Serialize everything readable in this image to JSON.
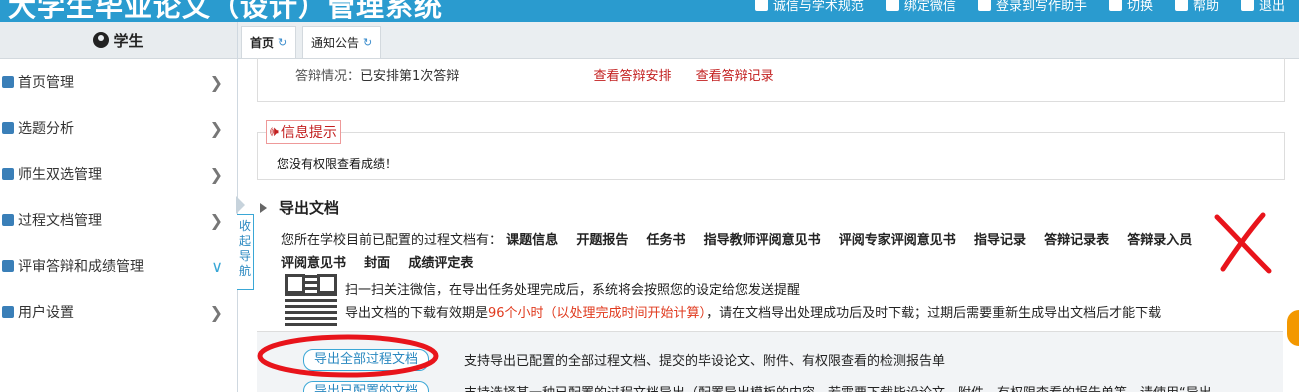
{
  "header": {
    "system_name": "大学生毕业论文（设计）管理系统",
    "links": [
      {
        "label": "诚信与学术规范",
        "icon": "document-icon"
      },
      {
        "label": "绑定微信",
        "icon": "wechat-icon"
      },
      {
        "label": "登录到写作助手",
        "icon": "login-icon"
      },
      {
        "label": "切换",
        "icon": "switch-icon"
      },
      {
        "label": "帮助",
        "icon": "help-icon"
      },
      {
        "label": "退出",
        "icon": "logout-icon"
      }
    ]
  },
  "sidebar": {
    "role": "学生",
    "items": [
      {
        "label": "首页管理",
        "icon": "wrench-icon"
      },
      {
        "label": "选题分析",
        "icon": "list-icon"
      },
      {
        "label": "师生双选管理",
        "icon": "users-icon"
      },
      {
        "label": "过程文档管理",
        "icon": "folder-icon"
      },
      {
        "label": "评审答辩和成绩管理",
        "icon": "chart-icon"
      },
      {
        "label": "用户设置",
        "icon": "user-icon"
      }
    ],
    "collapse_label": "收起导航"
  },
  "tabs": [
    {
      "label": "首页",
      "icon": "refresh-icon"
    },
    {
      "label": "通知公告",
      "icon": "refresh-icon"
    }
  ],
  "defense": {
    "status_label": "答辩情况：",
    "status_value": "已安排第1次答辩",
    "view_schedule": "查看答辩安排",
    "view_record": "查看答辩记录"
  },
  "info": {
    "title": "信息提示",
    "message": "您没有权限查看成绩！"
  },
  "export": {
    "section_title": "导出文档",
    "intro": "您所在学校目前已配置的过程文档有：",
    "docs": [
      "课题信息",
      "开题报告",
      "任务书",
      "指导教师评阅意见书",
      "评阅专家评阅意见书",
      "指导记录",
      "答辩记录表",
      "答辩录入员",
      "评阅意见书",
      "封面",
      "成绩评定表"
    ],
    "qr_note": "扫一扫关注微信，在导出任务处理完成后，系统将会按照您的设定给您发送提醒",
    "validity_prefix": "导出文档的下载有效期是",
    "validity_highlight": "96个小时（以处理完成时间开始计算）",
    "validity_suffix": "，请在文档导出处理成功后及时下载；过期后需要重新生成导出文档后才能下载",
    "btn_all": "导出全部过程文档",
    "btn_all_desc": "支持导出已配置的全部过程文档、提交的毕设论文、附件、有权限查看的检测报告单",
    "btn_configured": "导出已配置的文档",
    "btn_configured_desc": "支持选择某一种已配置的过程文档导出（配置导出模板的内容，若需要下载毕设论文、附件、有权限查看的报告单等，请使用“导出"
  },
  "colors": {
    "header_bg": "#2a9bcf",
    "accent": "#3aa7d6",
    "link_red": "#c21f1f",
    "annotation_red": "#e8141b"
  }
}
